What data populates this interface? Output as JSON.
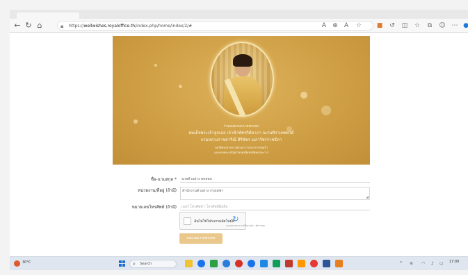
{
  "browser": {
    "url_prefix": "https://",
    "url_host": "wellwishes.royaloffice.th",
    "url_path": "/index.php/home/index/2/#",
    "reader_label": "Aᴬ"
  },
  "banner": {
    "line1": "ร่วมลงนามถวายพระพร",
    "line2": "สมเด็จพระเจ้าลูกเธอ เจ้าฟ้าพัชรกิติยาภา นเรนทิราเทพยวดี",
    "line3": "กรมหลวงราชสาริณี สิริพัชร มหาวัชรราชธิดา",
    "line4": "ขอให้ทรงหายจากพระอาการประชวรโดยเร็ว",
    "line5": "และทรงพระเจริญด้วยจตุรพิธพรชัยทุกประการ"
  },
  "form": {
    "name_label": "ชื่อ-นามสกุล *",
    "name_value": "นายตัวอย่าง ทดสอบ",
    "address_label": "หน่วยงาน/ที่อยู่ (ถ้ามี)",
    "address_value": "สำนักงานตัวอย่าง กรุงเทพฯ",
    "phone_label": "หมายเลขโทรศัพท์ (ถ้ามี)",
    "phone_value": "เบอร์ โทรศัพท์ / โทรศัพท์มือถือ",
    "captcha_label": "ฉันไม่ใช่โปรแกรมอัตโนมัติ",
    "captcha_sub": "reCAPTCHA\nความเป็นส่วนตัว - ข้อกำหนด",
    "submit_label": "ลงนามถวายพระพร"
  },
  "taskbar": {
    "weather_text": "30°C",
    "search_placeholder": "Search",
    "clock_time": "17:00"
  },
  "colors": {
    "banner_gold": "#cf9f45",
    "submit_button": "#eac88b",
    "taskbar": "#dfe6ef"
  }
}
